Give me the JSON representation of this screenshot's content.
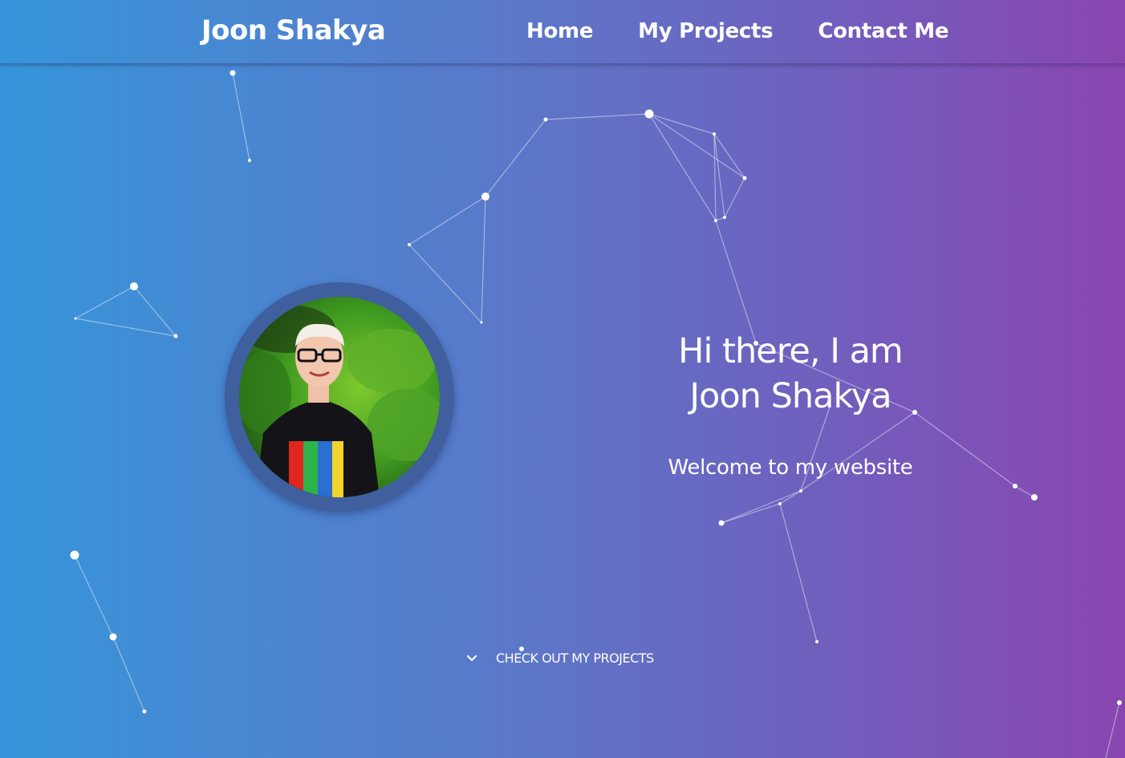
{
  "colors": {
    "gradient_start": "#3695da",
    "gradient_end": "#8a46b0",
    "text": "#ffffff",
    "avatar_ring": "#3f5f9e"
  },
  "navbar": {
    "brand": "Joon Shakya",
    "links": [
      {
        "label": "Home"
      },
      {
        "label": "My Projects"
      },
      {
        "label": "Contact Me"
      }
    ]
  },
  "hero": {
    "title_line1": "Hi there, I am",
    "title_line2": "Joon Shakya",
    "subtitle": "Welcome to my website",
    "avatar_icon": "profile-photo"
  },
  "cta": {
    "icon": "chevron-down-icon",
    "label": "CHECK OUT MY PROJECTS"
  }
}
